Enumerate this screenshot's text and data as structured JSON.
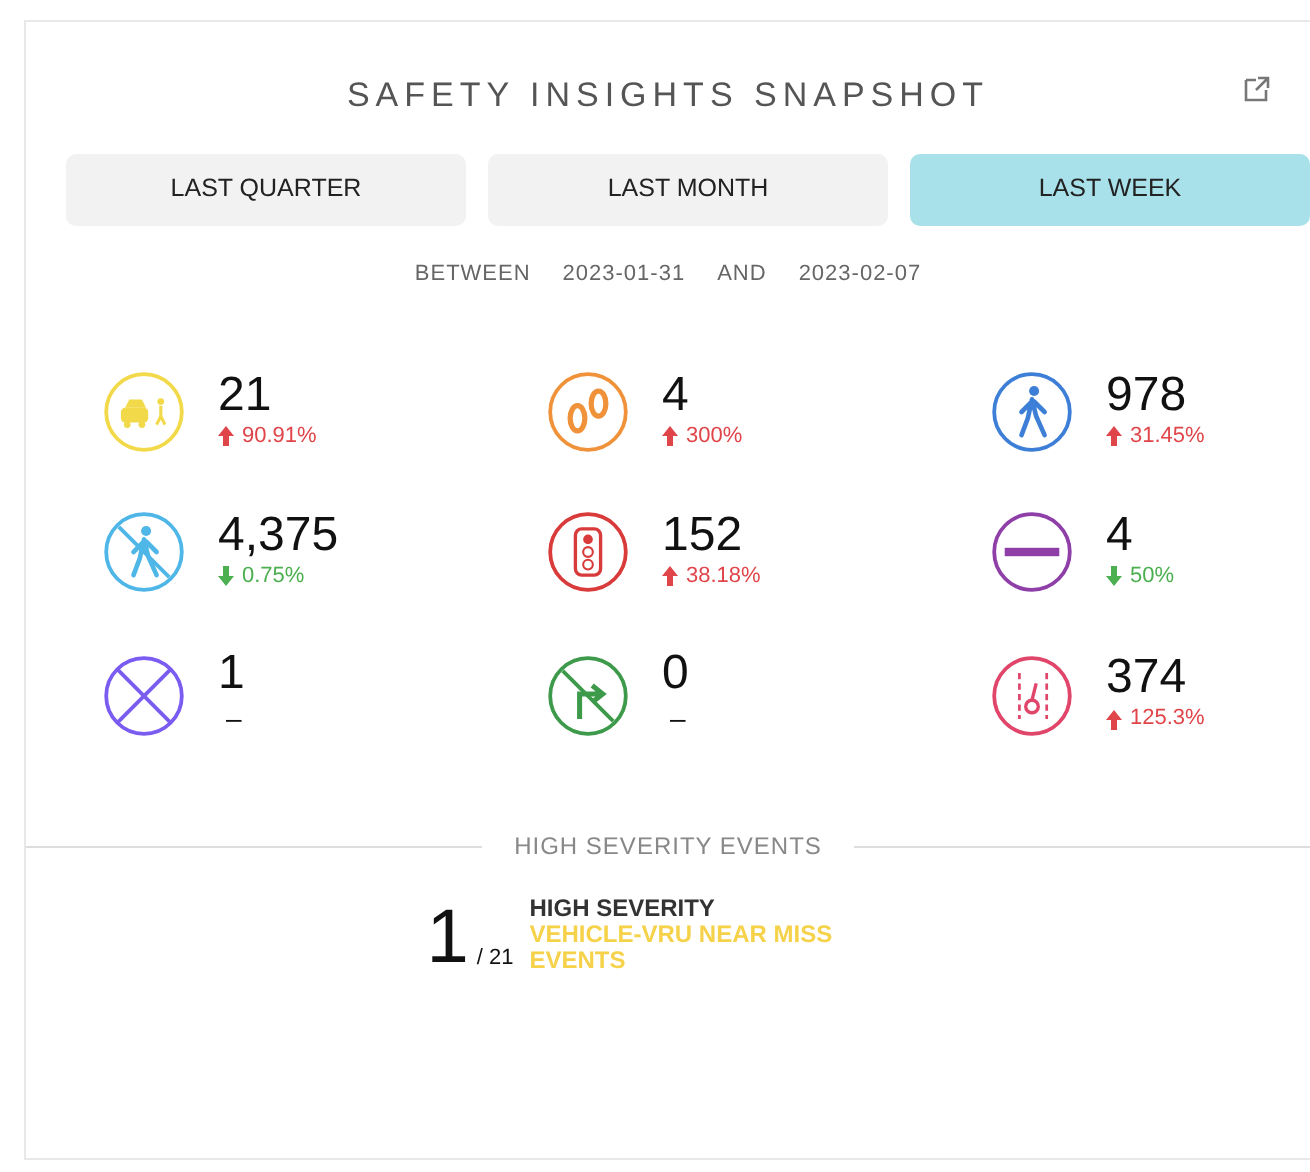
{
  "title": "SAFETY INSIGHTS SNAPSHOT",
  "tabs": [
    {
      "label": "LAST QUARTER",
      "selected": false
    },
    {
      "label": "LAST MONTH",
      "selected": false
    },
    {
      "label": "LAST WEEK",
      "selected": true
    }
  ],
  "range": {
    "prefix": "BETWEEN",
    "start": "2023-01-31",
    "joiner": "AND",
    "end": "2023-02-07"
  },
  "metrics": [
    {
      "kind": "car-pedestrian",
      "color": "#f2d94a",
      "value": "21",
      "change": {
        "kind": "up",
        "text": "90.91%"
      }
    },
    {
      "kind": "footprints",
      "color": "#f0923a",
      "value": "4",
      "change": {
        "kind": "up",
        "text": "300%"
      }
    },
    {
      "kind": "pedestrian",
      "color": "#3d7fd6",
      "value": "978",
      "change": {
        "kind": "up",
        "text": "31.45%"
      }
    },
    {
      "kind": "jaywalk",
      "color": "#4fb6e8",
      "value": "4,375",
      "change": {
        "kind": "down",
        "text": "0.75%"
      }
    },
    {
      "kind": "traffic-light",
      "color": "#d93a3a",
      "value": "152",
      "change": {
        "kind": "up",
        "text": "38.18%"
      }
    },
    {
      "kind": "no-entry",
      "color": "#8e3fa8",
      "value": "4",
      "change": {
        "kind": "down",
        "text": "50%"
      }
    },
    {
      "kind": "cross",
      "color": "#7a5cf0",
      "value": "1",
      "change": {
        "kind": "none",
        "text": "–"
      }
    },
    {
      "kind": "no-turn",
      "color": "#3c9a4a",
      "value": "0",
      "change": {
        "kind": "none",
        "text": "–"
      }
    },
    {
      "kind": "lane",
      "color": "#e0456a",
      "value": "374",
      "change": {
        "kind": "up",
        "text": "125.3%"
      }
    }
  ],
  "high_severity": {
    "heading": "HIGH SEVERITY EVENTS",
    "count": "1",
    "total": "/ 21",
    "label": "HIGH SEVERITY",
    "sublabel": "VEHICLE-VRU NEAR MISS EVENTS"
  }
}
